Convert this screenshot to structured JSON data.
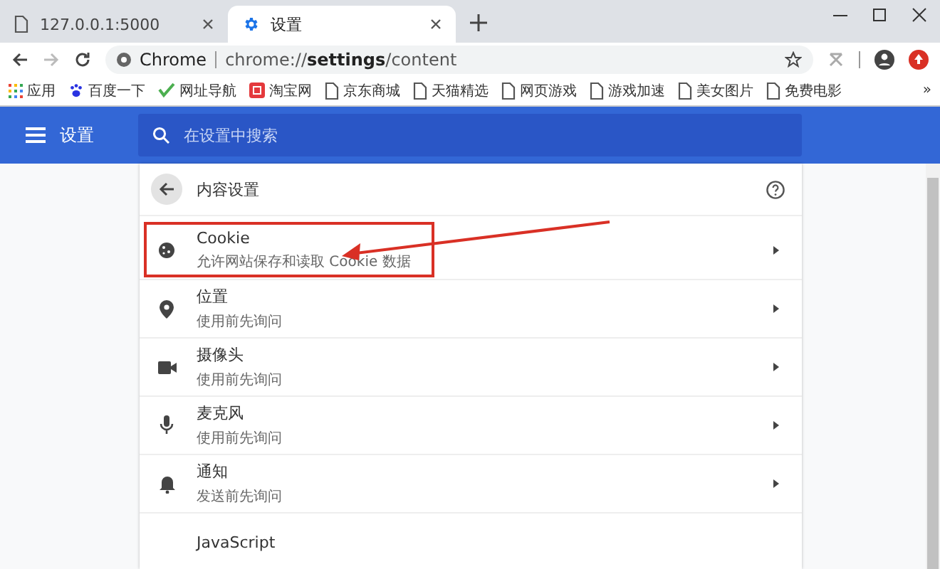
{
  "tabs": [
    {
      "label": "127.0.0.1:5000",
      "selected": false
    },
    {
      "label": "设置",
      "selected": true
    }
  ],
  "address": {
    "site": "Chrome",
    "url": "chrome://**settings**/content"
  },
  "bookmarks": [
    "应用",
    "百度一下",
    "网址导航",
    "淘宝网",
    "京东商城",
    "天猫精选",
    "网页游戏",
    "游戏加速",
    "美女图片",
    "免费电影"
  ],
  "bookmarks_overflow": "»",
  "header": {
    "title": "设置",
    "search_placeholder": "在设置中搜索"
  },
  "page": {
    "title": "内容设置"
  },
  "items": [
    {
      "title": "Cookie",
      "subtitle": "允许网站保存和读取 Cookie 数据",
      "highlighted": true
    },
    {
      "title": "位置",
      "subtitle": "使用前先询问",
      "highlighted": false
    },
    {
      "title": "摄像头",
      "subtitle": "使用前先询问",
      "highlighted": false
    },
    {
      "title": "麦克风",
      "subtitle": "使用前先询问",
      "highlighted": false
    },
    {
      "title": "通知",
      "subtitle": "发送前先询问",
      "highlighted": false
    },
    {
      "title": "JavaScript",
      "highlighted": false
    }
  ]
}
